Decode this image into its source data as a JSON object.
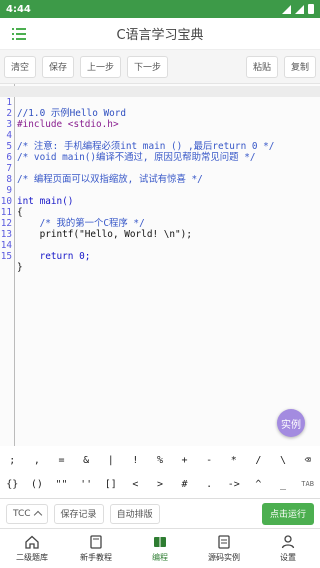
{
  "status": {
    "time": "4:44"
  },
  "header": {
    "title": "C语言学习宝典"
  },
  "toolbar": {
    "clear": "清空",
    "save": "保存",
    "prev": "上一步",
    "next": "下一步",
    "paste": "粘贴",
    "copy": "复制"
  },
  "editor": {
    "line_numbers": [
      "1",
      "2",
      "3",
      "4",
      "5",
      "6",
      "7",
      "8",
      "9",
      "10",
      "11",
      "12",
      "13",
      "14",
      "15"
    ],
    "lines": [
      "//1.0 示例Hello Word",
      "#include <stdio.h>",
      "",
      "/* 注意: 手机编程必须int main () ,最后return 0 */",
      "/* void main()编译不通过, 原因见帮助常见问题 */",
      "",
      "/* 编程页面可以双指缩放, 试试有惊喜 */",
      "",
      "int main()",
      "{",
      "    /* 我的第一个C程序 */",
      "    printf(\"Hello, World! \\n\");",
      "",
      "    return 0;",
      "}"
    ]
  },
  "example_button": "实例",
  "symbols_row1": [
    ";",
    ",",
    "=",
    "&",
    "|",
    "!",
    "%",
    "+",
    "-",
    "*",
    "/",
    "\\",
    "⌫"
  ],
  "symbols_row2": [
    "{}",
    "()",
    "\"\"",
    "''",
    "[]",
    "<",
    ">",
    "#",
    ".",
    "->",
    "^",
    "_",
    "TAB"
  ],
  "bottom": {
    "compiler": "TCC",
    "save_record": "保存记录",
    "auto_format": "自动排版",
    "run": "点击运行"
  },
  "tabs": [
    {
      "label": "二级题库",
      "icon": "home-icon"
    },
    {
      "label": "新手教程",
      "icon": "book-icon"
    },
    {
      "label": "编程",
      "icon": "code-book-icon",
      "active": true
    },
    {
      "label": "源码实例",
      "icon": "document-icon"
    },
    {
      "label": "设置",
      "icon": "person-icon"
    }
  ],
  "colors": {
    "accent": "#4caf50",
    "status_bar": "#3d9a48",
    "fab": "#a38be0"
  }
}
